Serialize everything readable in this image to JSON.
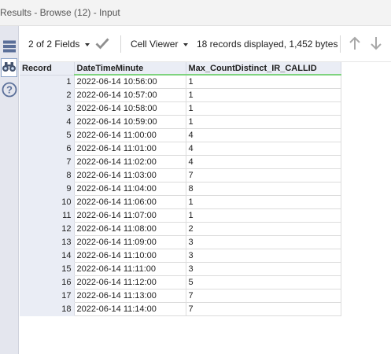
{
  "window": {
    "title": "Results - Browse (12) - Input"
  },
  "toolbar": {
    "fields_label": "2 of 2 Fields",
    "viewer_label": "Cell Viewer",
    "status": "18 records displayed, 1,452 bytes"
  },
  "sidebar": {
    "tools": [
      {
        "icon": "table-view-icon"
      },
      {
        "icon": "binoculars-icon"
      },
      {
        "icon": "help-icon"
      }
    ]
  },
  "colors": {
    "accent_green": "#7fd37f",
    "header_bg": "#eaedf5",
    "sidebar_bg": "#e4e6ee"
  },
  "table": {
    "columns": [
      "Record",
      "DateTimeMinute",
      "Max_CountDistinct_IR_CALLID"
    ],
    "rows": [
      [
        "1",
        "2022-06-14 10:56:00",
        "1"
      ],
      [
        "2",
        "2022-06-14 10:57:00",
        "1"
      ],
      [
        "3",
        "2022-06-14 10:58:00",
        "1"
      ],
      [
        "4",
        "2022-06-14 10:59:00",
        "1"
      ],
      [
        "5",
        "2022-06-14 11:00:00",
        "4"
      ],
      [
        "6",
        "2022-06-14 11:01:00",
        "4"
      ],
      [
        "7",
        "2022-06-14 11:02:00",
        "4"
      ],
      [
        "8",
        "2022-06-14 11:03:00",
        "7"
      ],
      [
        "9",
        "2022-06-14 11:04:00",
        "8"
      ],
      [
        "10",
        "2022-06-14 11:06:00",
        "1"
      ],
      [
        "11",
        "2022-06-14 11:07:00",
        "1"
      ],
      [
        "12",
        "2022-06-14 11:08:00",
        "2"
      ],
      [
        "13",
        "2022-06-14 11:09:00",
        "3"
      ],
      [
        "14",
        "2022-06-14 11:10:00",
        "3"
      ],
      [
        "15",
        "2022-06-14 11:11:00",
        "3"
      ],
      [
        "16",
        "2022-06-14 11:12:00",
        "5"
      ],
      [
        "17",
        "2022-06-14 11:13:00",
        "7"
      ],
      [
        "18",
        "2022-06-14 11:14:00",
        "7"
      ]
    ]
  }
}
